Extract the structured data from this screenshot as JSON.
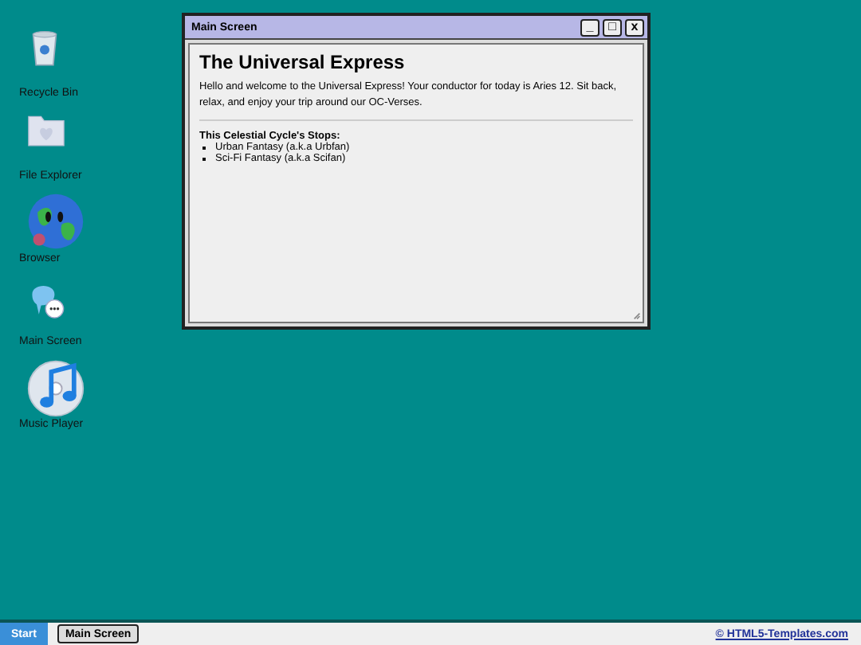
{
  "desktop_icons": [
    {
      "kind": "bin",
      "label": "Recycle Bin"
    },
    {
      "kind": "folder",
      "label": "File Explorer"
    },
    {
      "kind": "globe",
      "label": "Browser"
    },
    {
      "kind": "chat",
      "label": "Main Screen"
    },
    {
      "kind": "music",
      "label": "Music Player"
    }
  ],
  "window": {
    "title": "Main Screen",
    "controls": [
      "_",
      "□",
      "x"
    ],
    "heading": "The Universal Express",
    "intro": "Hello and welcome to the Universal Express! Your conductor for today is Aries 12. Sit back, relax, and enjoy your trip around our OC-Verses.",
    "list_title": "This Celestial Cycle's Stops:",
    "stops": [
      "Urban Fantasy (a.k.a Urbfan)",
      "Sci-Fi Fantasy (a.k.a Scifan)"
    ]
  },
  "taskbar": {
    "start": "Start",
    "tasks": [
      "Main Screen"
    ],
    "credit": "© HTML5-Templates.com"
  }
}
